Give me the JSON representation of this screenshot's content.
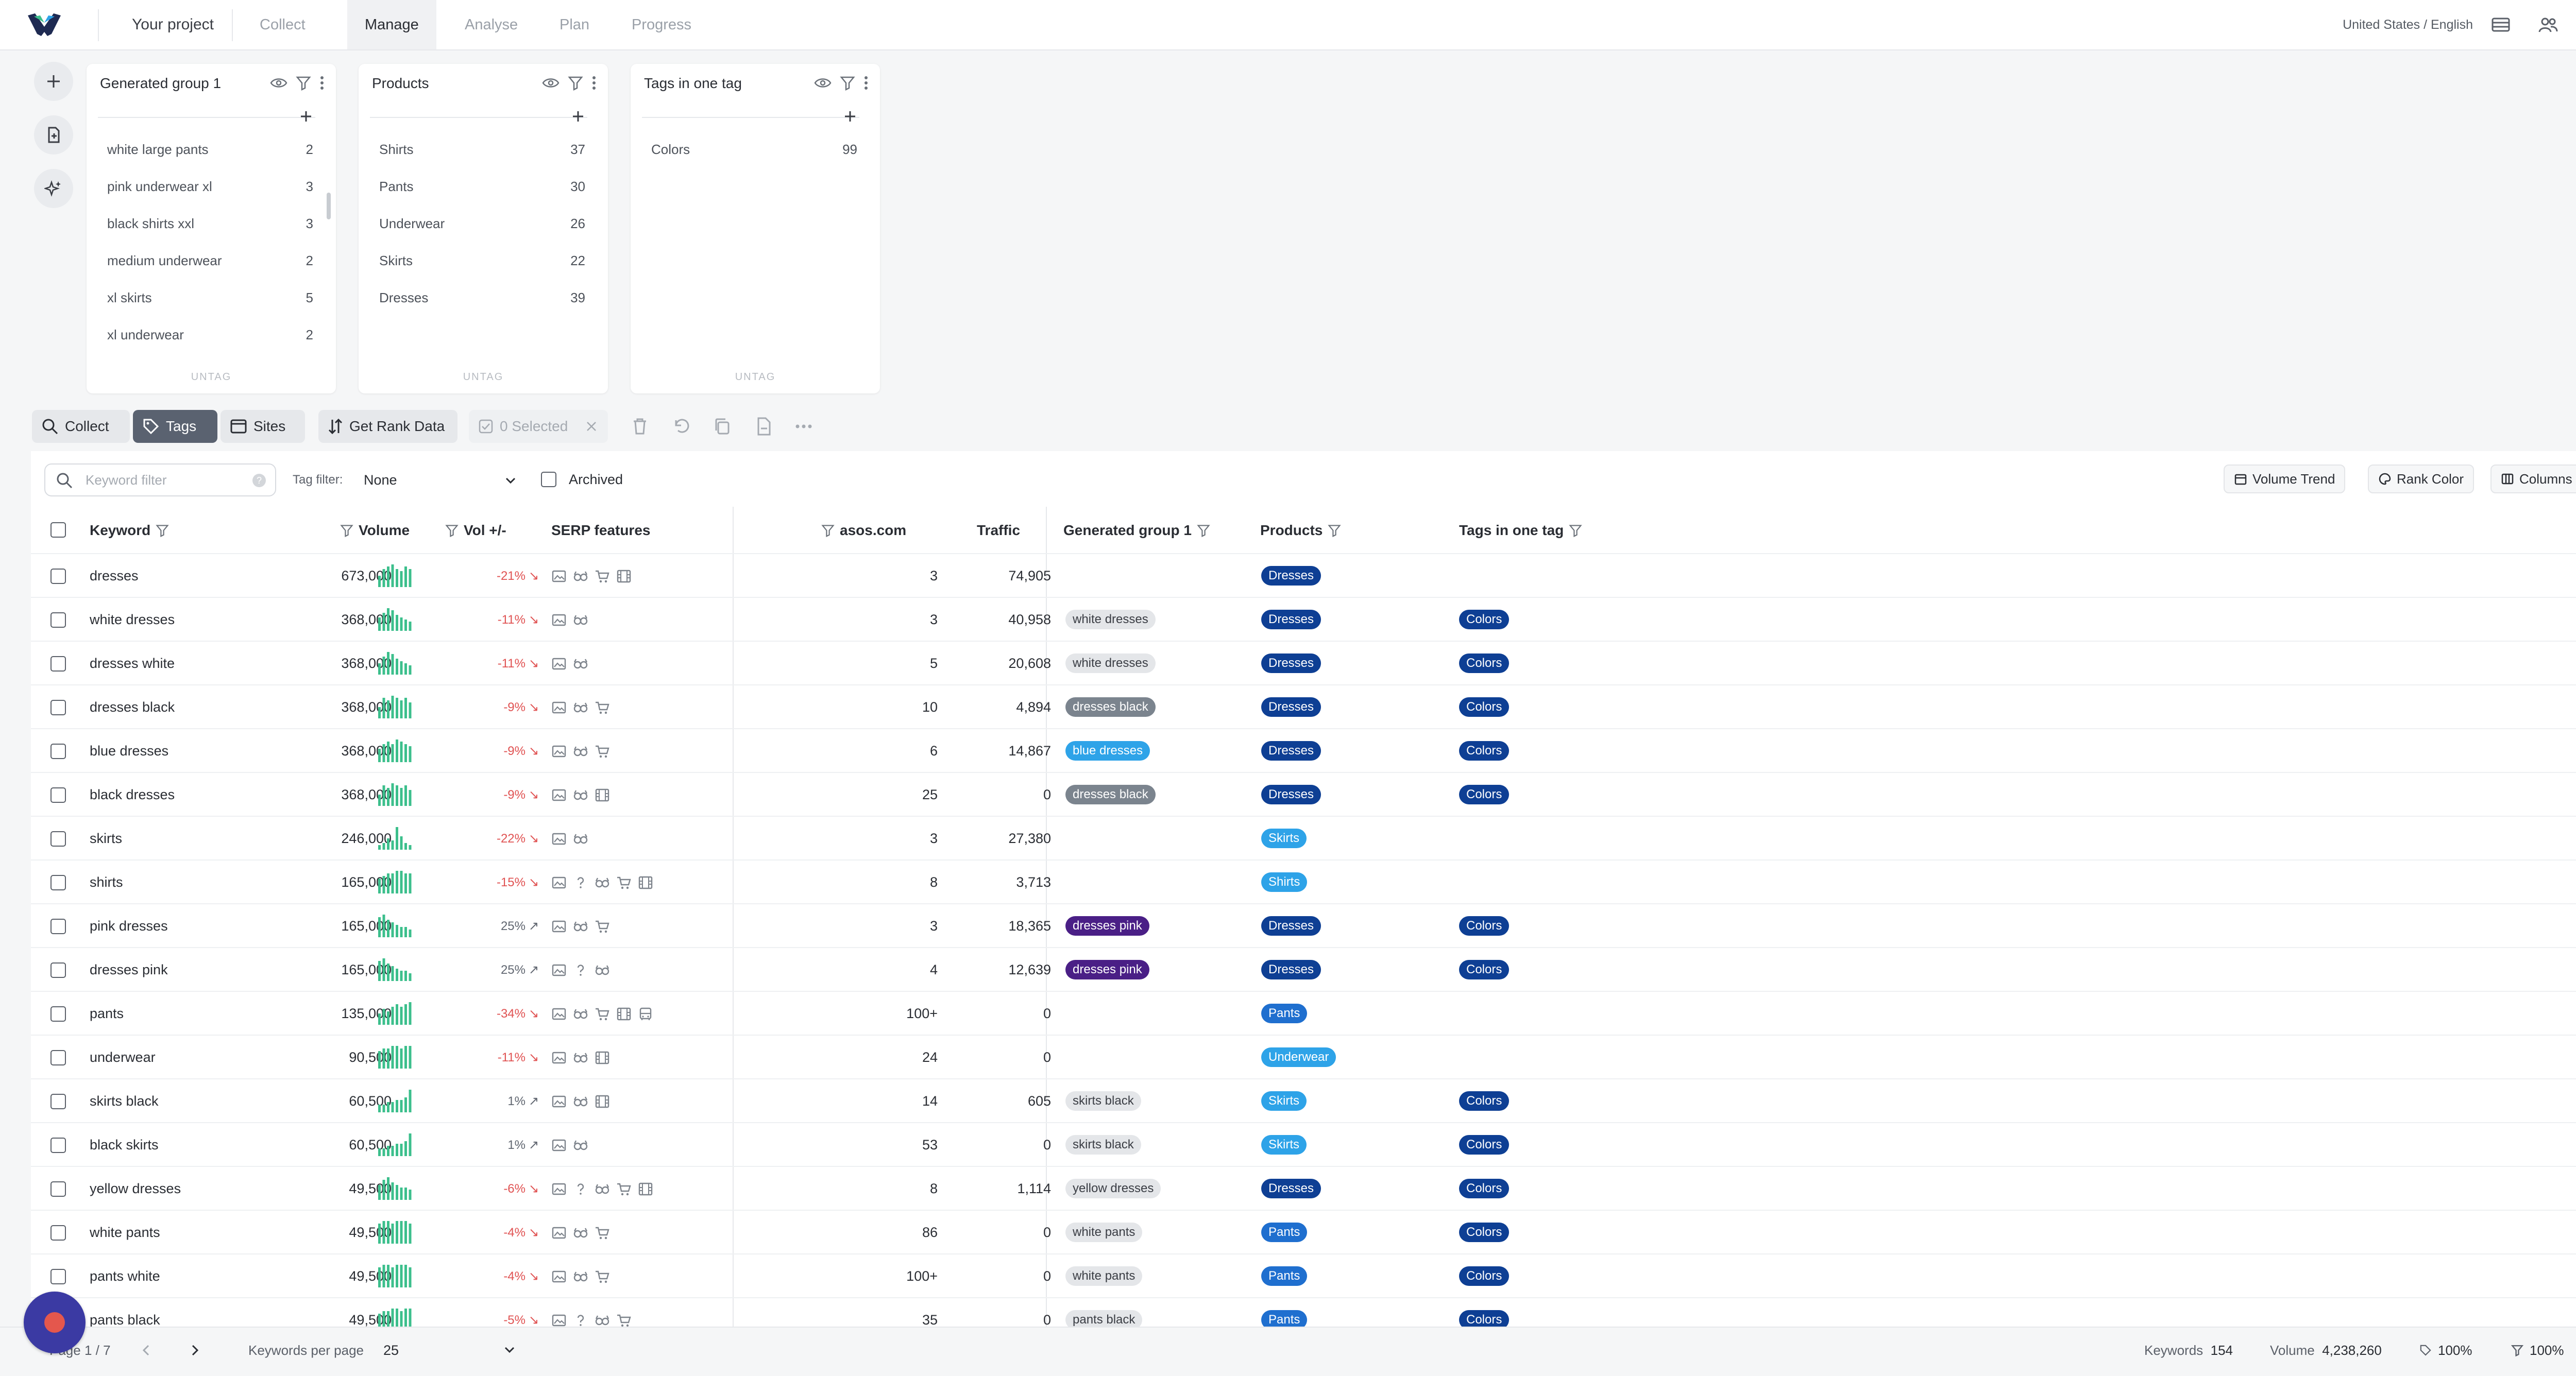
{
  "nav": {
    "project": "Your project",
    "tabs": [
      "Collect",
      "Manage",
      "Analyse",
      "Plan",
      "Progress"
    ],
    "active_tab": "Manage",
    "locale": "United States / English"
  },
  "groups": [
    {
      "title": "Generated group 1",
      "items": [
        {
          "label": "white large pants",
          "count": "2"
        },
        {
          "label": "pink underwear xl",
          "count": "3"
        },
        {
          "label": "black shirts xxl",
          "count": "3"
        },
        {
          "label": "medium underwear",
          "count": "2"
        },
        {
          "label": "xl skirts",
          "count": "5"
        },
        {
          "label": "xl underwear",
          "count": "2"
        }
      ],
      "untag": "UNTAG"
    },
    {
      "title": "Products",
      "items": [
        {
          "label": "Shirts",
          "count": "37"
        },
        {
          "label": "Pants",
          "count": "30"
        },
        {
          "label": "Underwear",
          "count": "26"
        },
        {
          "label": "Skirts",
          "count": "22"
        },
        {
          "label": "Dresses",
          "count": "39"
        }
      ],
      "untag": "UNTAG"
    },
    {
      "title": "Tags in one tag",
      "items": [
        {
          "label": "Colors",
          "count": "99"
        }
      ],
      "untag": "UNTAG"
    }
  ],
  "toolbar": {
    "collect": "Collect",
    "tags": "Tags",
    "sites": "Sites",
    "rank_data": "Get Rank Data",
    "selected": "0 Selected"
  },
  "filters": {
    "keyword_placeholder": "Keyword filter",
    "tag_filter_label": "Tag filter:",
    "tag_filter_value": "None",
    "archived": "Archived",
    "volume_trend": "Volume Trend",
    "rank_color": "Rank Color",
    "columns": "Columns"
  },
  "table": {
    "headers": {
      "keyword": "Keyword",
      "volume": "Volume",
      "vol_change": "Vol +/-",
      "serp": "SERP features",
      "site": "asos.com",
      "traffic": "Traffic",
      "group1": "Generated group 1",
      "products": "Products",
      "tags_one": "Tags in one tag"
    },
    "rows": [
      {
        "keyword": "dresses",
        "volume": "673,000",
        "trend": [
          5,
          8,
          9,
          10,
          8,
          7,
          9,
          8
        ],
        "change": "-21%",
        "dir": "down",
        "serp": [
          "image",
          "glasses",
          "cart",
          "film"
        ],
        "rank": "3",
        "traffic": "74,905",
        "group": "",
        "group_color": "",
        "product": "Dresses",
        "color_tag": ""
      },
      {
        "keyword": "white dresses",
        "volume": "368,000",
        "trend": [
          6,
          8,
          10,
          9,
          7,
          6,
          5,
          4
        ],
        "change": "-11%",
        "dir": "down",
        "serp": [
          "image",
          "glasses"
        ],
        "rank": "3",
        "traffic": "40,958",
        "group": "white dresses",
        "group_color": "#e4e6e9",
        "product": "Dresses",
        "color_tag": "Colors"
      },
      {
        "keyword": "dresses white",
        "volume": "368,000",
        "trend": [
          5,
          8,
          10,
          9,
          7,
          6,
          5,
          4
        ],
        "change": "-11%",
        "dir": "down",
        "serp": [
          "image",
          "glasses"
        ],
        "rank": "5",
        "traffic": "20,608",
        "group": "white dresses",
        "group_color": "#e4e6e9",
        "product": "Dresses",
        "color_tag": "Colors"
      },
      {
        "keyword": "dresses black",
        "volume": "368,000",
        "trend": [
          5,
          9,
          8,
          10,
          9,
          8,
          9,
          7
        ],
        "change": "-9%",
        "dir": "down",
        "serp": [
          "image",
          "glasses",
          "cart"
        ],
        "rank": "10",
        "traffic": "4,894",
        "group": "dresses black",
        "group_color": "#7b848e",
        "product": "Dresses",
        "color_tag": "Colors"
      },
      {
        "keyword": "blue dresses",
        "volume": "368,000",
        "trend": [
          6,
          8,
          9,
          8,
          10,
          9,
          8,
          7
        ],
        "change": "-9%",
        "dir": "down",
        "serp": [
          "image",
          "glasses",
          "cart"
        ],
        "rank": "6",
        "traffic": "14,867",
        "group": "blue dresses",
        "group_color": "#2ea3e8",
        "product": "Dresses",
        "color_tag": "Colors"
      },
      {
        "keyword": "black dresses",
        "volume": "368,000",
        "trend": [
          5,
          9,
          8,
          10,
          9,
          8,
          9,
          7
        ],
        "change": "-9%",
        "dir": "down",
        "serp": [
          "image",
          "glasses",
          "film"
        ],
        "rank": "25",
        "traffic": "0",
        "group": "dresses black",
        "group_color": "#7b848e",
        "product": "Dresses",
        "color_tag": "Colors"
      },
      {
        "keyword": "skirts",
        "volume": "246,000",
        "trend": [
          2,
          3,
          5,
          4,
          10,
          6,
          3,
          2
        ],
        "change": "-22%",
        "dir": "down",
        "serp": [
          "image",
          "glasses"
        ],
        "rank": "3",
        "traffic": "27,380",
        "group": "",
        "group_color": "",
        "product": "Skirts",
        "color_tag": ""
      },
      {
        "keyword": "shirts",
        "volume": "165,000",
        "trend": [
          6,
          7,
          8,
          8,
          9,
          9,
          8,
          8
        ],
        "change": "-15%",
        "dir": "down",
        "serp": [
          "image",
          "question",
          "glasses",
          "cart",
          "film"
        ],
        "rank": "8",
        "traffic": "3,713",
        "group": "",
        "group_color": "",
        "product": "Shirts",
        "color_tag": ""
      },
      {
        "keyword": "pink dresses",
        "volume": "165,000",
        "trend": [
          8,
          9,
          7,
          6,
          5,
          4,
          4,
          3
        ],
        "change": "25%",
        "dir": "up",
        "serp": [
          "image",
          "glasses",
          "cart"
        ],
        "rank": "3",
        "traffic": "18,365",
        "group": "dresses pink",
        "group_color": "#4a1f86",
        "product": "Dresses",
        "color_tag": "Colors"
      },
      {
        "keyword": "dresses pink",
        "volume": "165,000",
        "trend": [
          8,
          9,
          7,
          6,
          5,
          4,
          4,
          3
        ],
        "change": "25%",
        "dir": "up",
        "serp": [
          "image",
          "question",
          "glasses"
        ],
        "rank": "4",
        "traffic": "12,639",
        "group": "dresses pink",
        "group_color": "#4a1f86",
        "product": "Dresses",
        "color_tag": "Colors"
      },
      {
        "keyword": "pants",
        "volume": "135,000",
        "trend": [
          5,
          7,
          6,
          8,
          9,
          8,
          9,
          10
        ],
        "change": "-34%",
        "dir": "down",
        "serp": [
          "image",
          "glasses",
          "cart",
          "film",
          "bus"
        ],
        "rank": "100+",
        "traffic": "0",
        "group": "",
        "group_color": "",
        "product": "Pants",
        "color_tag": ""
      },
      {
        "keyword": "underwear",
        "volume": "90,500",
        "trend": [
          7,
          8,
          8,
          9,
          9,
          8,
          9,
          9
        ],
        "change": "-11%",
        "dir": "down",
        "serp": [
          "image",
          "glasses",
          "film"
        ],
        "rank": "24",
        "traffic": "0",
        "group": "",
        "group_color": "",
        "product": "Underwear",
        "color_tag": ""
      },
      {
        "keyword": "skirts black",
        "volume": "60,500",
        "trend": [
          3,
          3,
          4,
          4,
          5,
          5,
          6,
          9
        ],
        "change": "1%",
        "dir": "up",
        "serp": [
          "image",
          "glasses",
          "film"
        ],
        "rank": "14",
        "traffic": "605",
        "group": "skirts black",
        "group_color": "#e4e6e9",
        "product": "Skirts",
        "color_tag": "Colors"
      },
      {
        "keyword": "black skirts",
        "volume": "60,500",
        "trend": [
          3,
          3,
          4,
          4,
          5,
          5,
          6,
          9
        ],
        "change": "1%",
        "dir": "up",
        "serp": [
          "image",
          "glasses"
        ],
        "rank": "53",
        "traffic": "0",
        "group": "skirts black",
        "group_color": "#e4e6e9",
        "product": "Skirts",
        "color_tag": "Colors"
      },
      {
        "keyword": "yellow dresses",
        "volume": "49,500",
        "trend": [
          6,
          8,
          9,
          7,
          6,
          5,
          5,
          4
        ],
        "change": "-6%",
        "dir": "down",
        "serp": [
          "image",
          "question",
          "glasses",
          "cart",
          "film"
        ],
        "rank": "8",
        "traffic": "1,114",
        "group": "yellow dresses",
        "group_color": "#e4e6e9",
        "product": "Dresses",
        "color_tag": "Colors"
      },
      {
        "keyword": "white pants",
        "volume": "49,500",
        "trend": [
          8,
          9,
          9,
          8,
          9,
          9,
          9,
          8
        ],
        "change": "-4%",
        "dir": "down",
        "serp": [
          "image",
          "glasses",
          "cart"
        ],
        "rank": "86",
        "traffic": "0",
        "group": "white pants",
        "group_color": "#e4e6e9",
        "product": "Pants",
        "color_tag": "Colors"
      },
      {
        "keyword": "pants white",
        "volume": "49,500",
        "trend": [
          8,
          9,
          9,
          8,
          9,
          9,
          9,
          8
        ],
        "change": "-4%",
        "dir": "down",
        "serp": [
          "image",
          "glasses",
          "cart"
        ],
        "rank": "100+",
        "traffic": "0",
        "group": "white pants",
        "group_color": "#e4e6e9",
        "product": "Pants",
        "color_tag": "Colors"
      },
      {
        "keyword": "pants black",
        "volume": "49,500",
        "trend": [
          7,
          8,
          8,
          9,
          9,
          8,
          9,
          9
        ],
        "change": "-5%",
        "dir": "down",
        "serp": [
          "image",
          "question",
          "glasses",
          "cart"
        ],
        "rank": "35",
        "traffic": "0",
        "group": "pants black",
        "group_color": "#e4e6e9",
        "product": "Pants",
        "color_tag": "Colors"
      }
    ]
  },
  "product_colors": {
    "Dresses": "#0e3f94",
    "Skirts": "#2ea3e8",
    "Shirts": "#2ea3e8",
    "Pants": "#1f6fcf",
    "Underwear": "#2ea3e8"
  },
  "colors": {
    "tag_colors": "#0e3f94",
    "spark": "#3cbf8c",
    "down": "#e05252",
    "up": "#606670",
    "record_button": "#3b3aa3"
  },
  "footer": {
    "page": "Page 1 / 7",
    "per_page_label": "Keywords per page",
    "per_page_value": "25",
    "keywords_label": "Keywords",
    "keywords_value": "154",
    "volume_label": "Volume",
    "volume_value": "4,238,260",
    "tag_pct": "100%",
    "filter_pct": "100%"
  }
}
